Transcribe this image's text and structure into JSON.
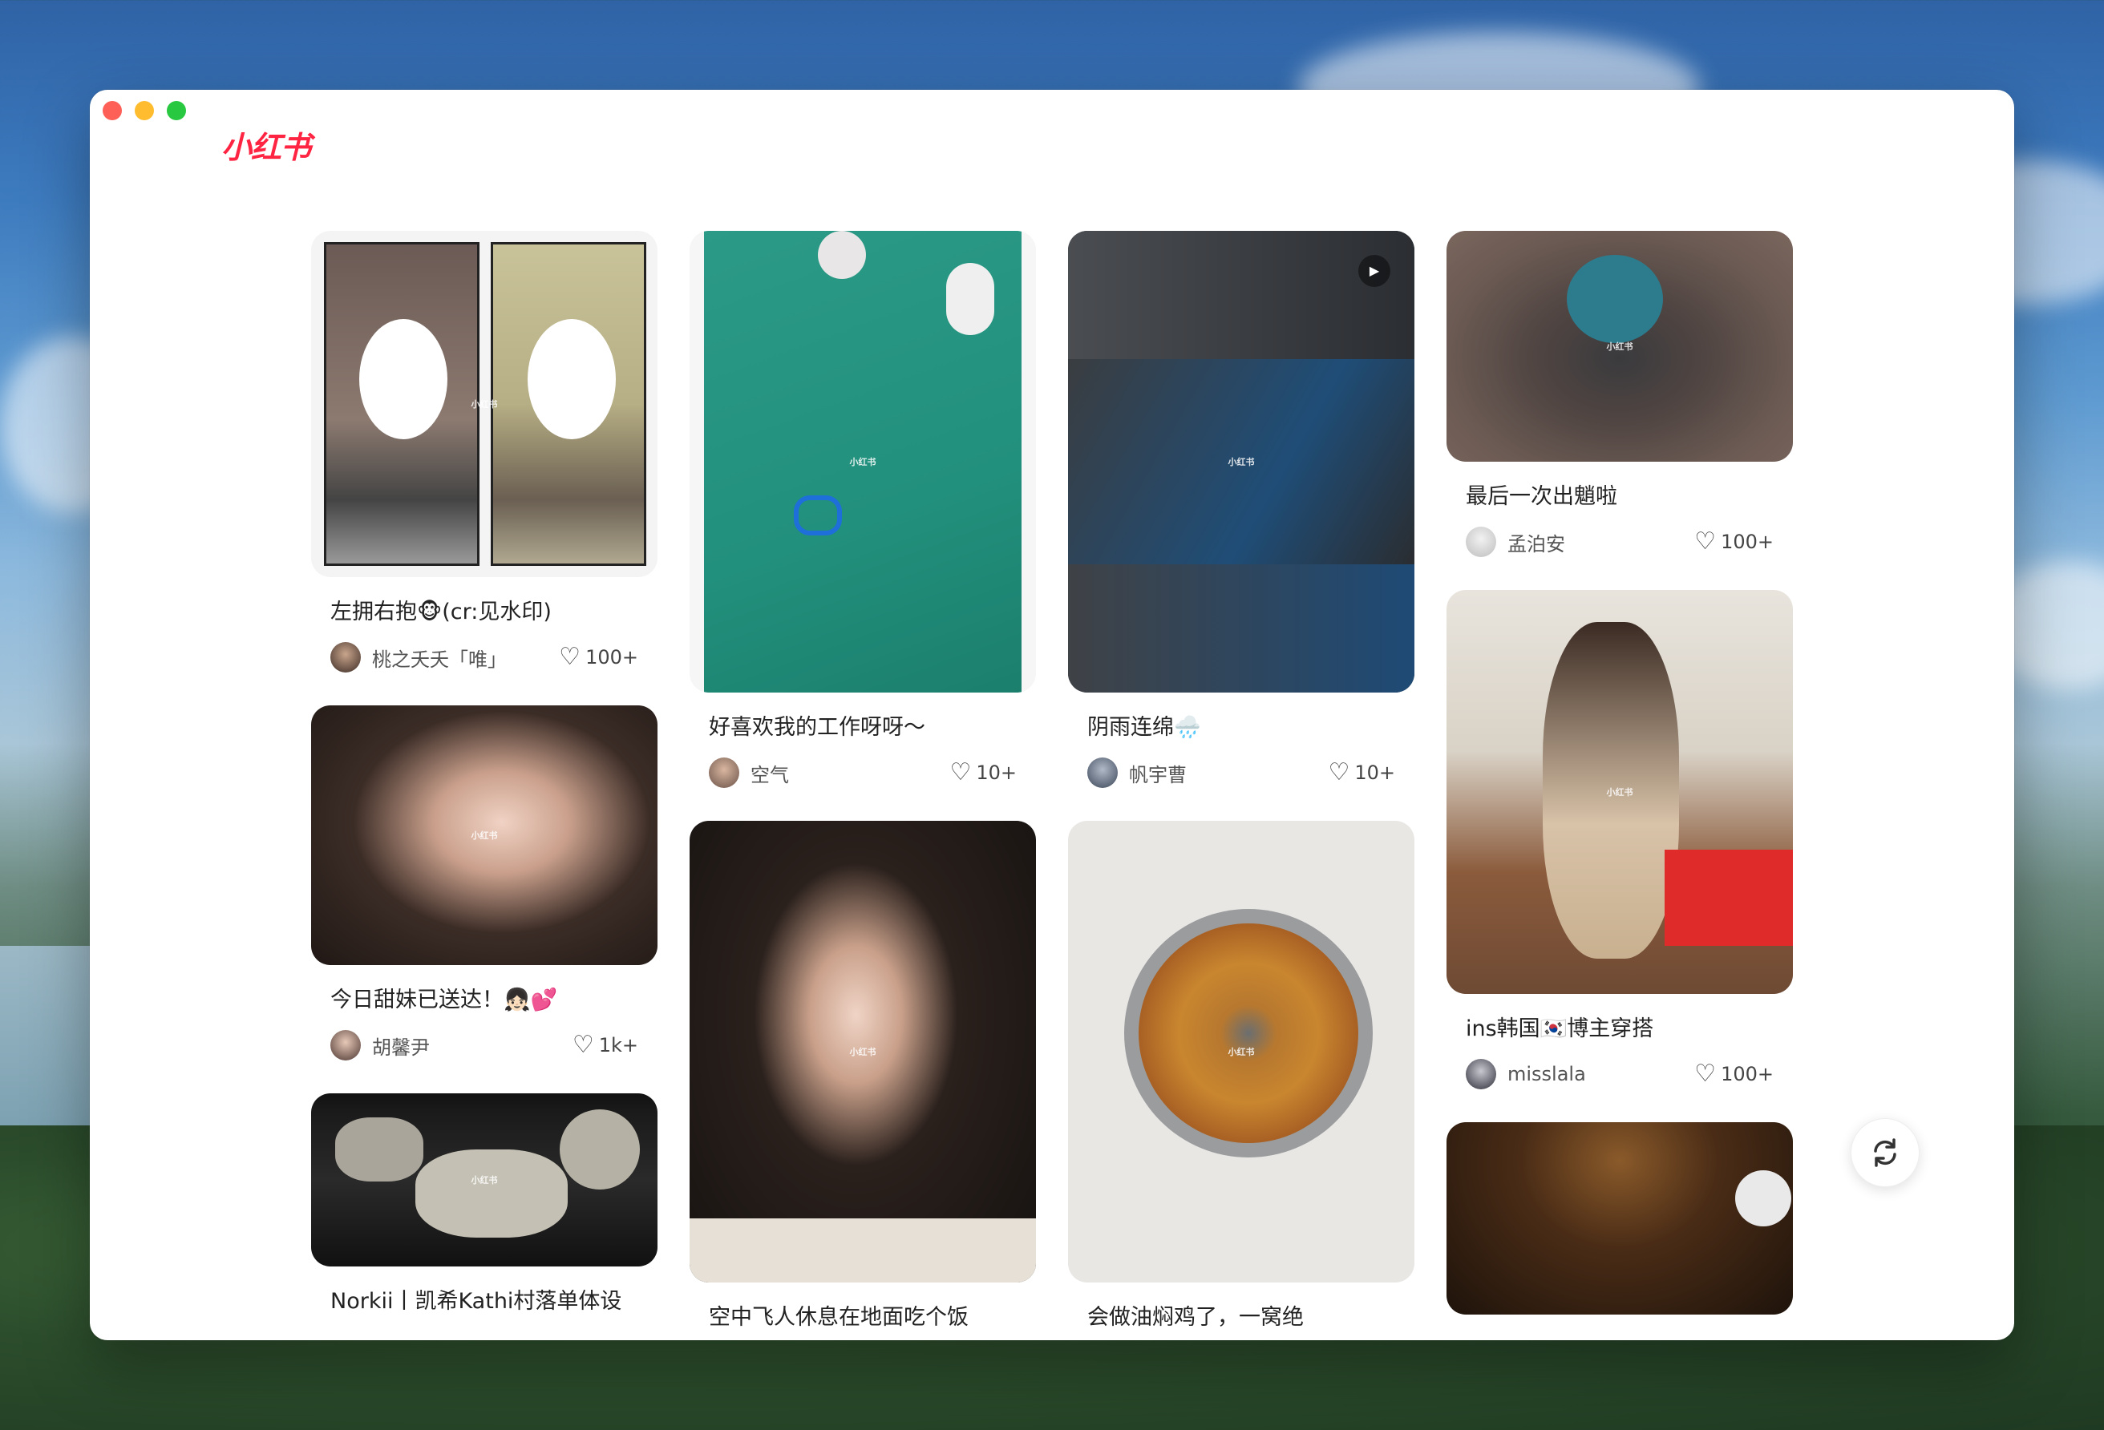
{
  "app": {
    "logo": "小红书"
  },
  "colors": {
    "brand": "#ff2442"
  },
  "feed": {
    "columns": [
      [
        {
          "title": "左拥右抱🐵(cr:见水印)",
          "author": "桃之夭夭「唯」",
          "likes": "100+"
        },
        {
          "title": "今日甜妹已送达！👧🏻💕",
          "author": "胡馨尹",
          "likes": "1k+"
        },
        {
          "title": "Norkii丨凯希Kathi村落单体设",
          "author": "",
          "likes": ""
        }
      ],
      [
        {
          "title": "好喜欢我的工作呀呀～",
          "author": "空气",
          "likes": "10+"
        },
        {
          "title": "空中飞人休息在地面吃个饭",
          "author": "",
          "likes": ""
        }
      ],
      [
        {
          "title": "阴雨连绵🌧️",
          "author": "帆宇曹",
          "likes": "10+"
        },
        {
          "title": "会做油焖鸡了，一窝绝",
          "author": "",
          "likes": ""
        }
      ],
      [
        {
          "title": "最后一次出魈啦",
          "author": "孟泊安",
          "likes": "100+"
        },
        {
          "title": "ins韩国🇰🇷博主穿搭",
          "author": "misslala",
          "likes": "100+"
        }
      ]
    ],
    "watermark": "小红书"
  },
  "icons": {
    "heart": "heart-outline-icon",
    "refresh": "refresh-icon",
    "play": "play-icon"
  }
}
